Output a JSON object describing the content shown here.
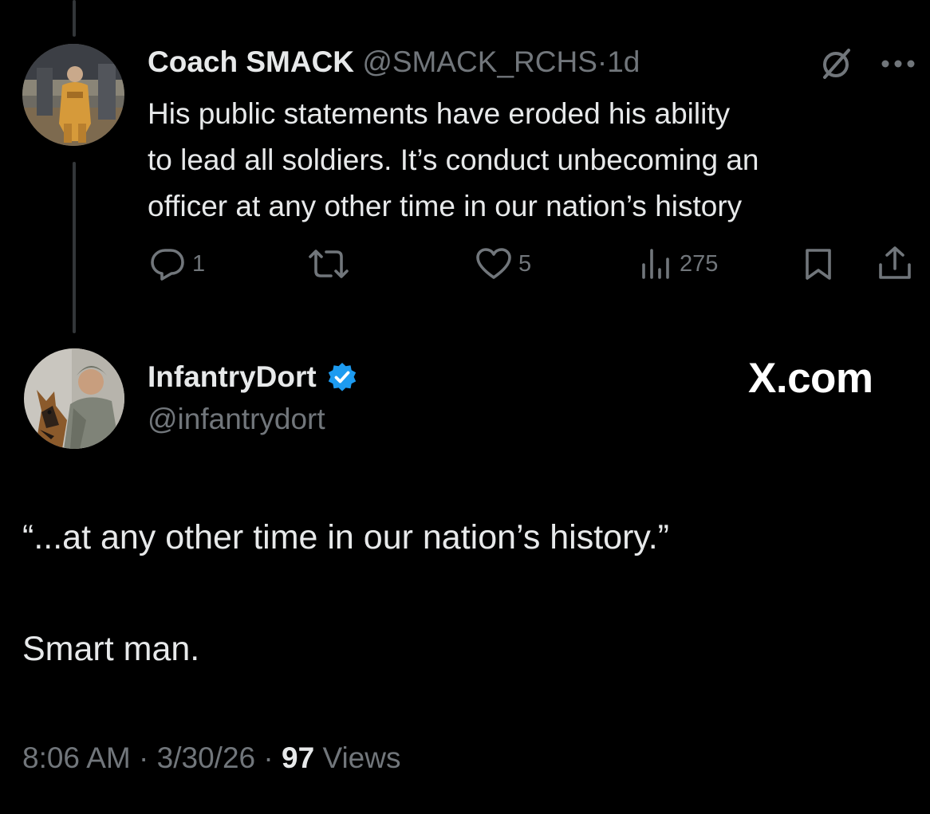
{
  "parent_tweet": {
    "author_name": "Coach SMACK",
    "handle": "@SMACK_RCHS",
    "separator": "·",
    "time": "1d",
    "text_lines": [
      "His public statements have eroded his ability",
      "to lead all soldiers. It’s conduct unbecoming an",
      "officer at any other time in our nation’s history"
    ],
    "actions": {
      "replies": "1",
      "reposts": "",
      "likes": "5",
      "views": "275"
    }
  },
  "main_tweet": {
    "author_name": "InfantryDort",
    "handle": "@infantrydort",
    "watermark": "X.com",
    "text_line_1": "“...at any other time in our nation’s history.”",
    "text_line_2": "Smart man.",
    "time": "8:06 AM",
    "date": "3/30/26",
    "views_count": "97",
    "views_label": "Views",
    "separator": "·"
  },
  "colors": {
    "background": "#000000",
    "text": "#e7e9ea",
    "muted": "#71767b",
    "verified": "#1d9bf0",
    "thread_line": "#333639"
  },
  "icons": [
    "reply-icon",
    "repost-icon",
    "like-icon",
    "views-icon",
    "bookmark-icon",
    "share-icon",
    "grok-icon",
    "more-icon",
    "verified-badge-icon"
  ]
}
